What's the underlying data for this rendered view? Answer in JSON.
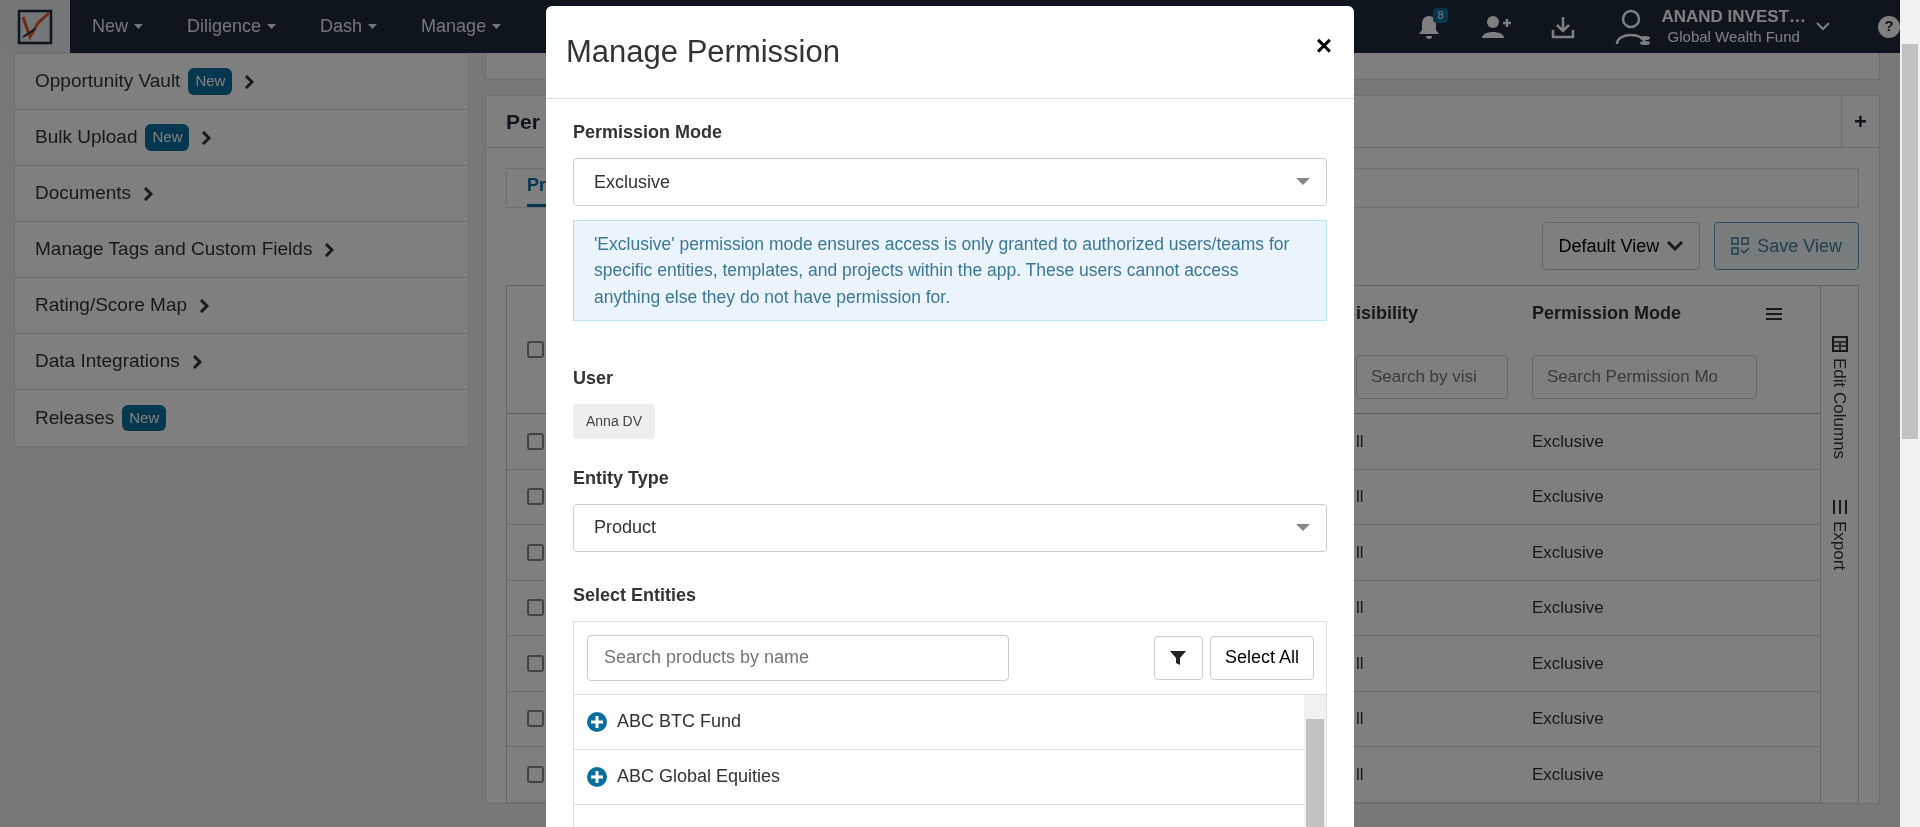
{
  "navbar": {
    "menus": [
      {
        "label": "New"
      },
      {
        "label": "Diligence"
      },
      {
        "label": "Dash"
      },
      {
        "label": "Manage"
      }
    ],
    "notification_count": "8",
    "account": {
      "name": "ANAND INVEST…",
      "fund": "Global Wealth Fund"
    },
    "help": "?"
  },
  "sidebar": {
    "items": [
      {
        "label": "Opportunity Vault",
        "badge": "New",
        "arrow": true
      },
      {
        "label": "Bulk Upload",
        "badge": "New",
        "arrow": true
      },
      {
        "label": "Documents",
        "arrow": true
      },
      {
        "label": "Manage Tags and Custom Fields",
        "arrow": true
      },
      {
        "label": "Rating/Score Map",
        "arrow": true
      },
      {
        "label": "Data Integrations",
        "arrow": true
      },
      {
        "label": "Releases",
        "badge": "New",
        "arrow": false
      }
    ]
  },
  "panel": {
    "title": "Per",
    "add_button": "+",
    "tabs": [
      {
        "label": "Pr",
        "selected": true
      }
    ],
    "view_dropdown": "Default View",
    "save_view_button": "Save View",
    "table": {
      "select_all_checked": false,
      "columns": [
        {
          "label": "isibility",
          "search_placeholder": "Search by visi"
        },
        {
          "label": "Permission Mode",
          "search_placeholder": "Search Permission Mo"
        }
      ],
      "rows": [
        {
          "checked": false,
          "visibility": "ll",
          "permission_mode": "Exclusive"
        },
        {
          "checked": false,
          "visibility": "ll",
          "permission_mode": "Exclusive"
        },
        {
          "checked": false,
          "visibility": "ll",
          "permission_mode": "Exclusive"
        },
        {
          "checked": false,
          "visibility": "ll",
          "permission_mode": "Exclusive"
        },
        {
          "checked": false,
          "visibility": "ll",
          "permission_mode": "Exclusive"
        },
        {
          "checked": false,
          "visibility": "ll",
          "permission_mode": "Exclusive"
        },
        {
          "checked": false,
          "visibility": "ll",
          "permission_mode": "Exclusive"
        }
      ]
    },
    "side_tools": [
      {
        "kind": "columns",
        "label": "Edit Columns"
      },
      {
        "kind": "export",
        "label": "Export"
      }
    ]
  },
  "modal": {
    "title": "Manage Permission",
    "close": "×",
    "permission_mode": {
      "label": "Permission Mode",
      "value": "Exclusive"
    },
    "info": "'Exclusive' permission mode ensures access is only granted to authorized users/teams for specific entities, templates, and projects within the app. These users cannot access anything else they do not have permission for.",
    "user": {
      "label": "User",
      "chips": [
        "Anna DV"
      ]
    },
    "entity_type": {
      "label": "Entity Type",
      "value": "Product"
    },
    "select_entities": {
      "label": "Select Entities",
      "search_placeholder": "Search products by name",
      "select_all": "Select All",
      "items": [
        {
          "label": "ABC BTC Fund"
        },
        {
          "label": "ABC Global Equities"
        }
      ]
    }
  }
}
